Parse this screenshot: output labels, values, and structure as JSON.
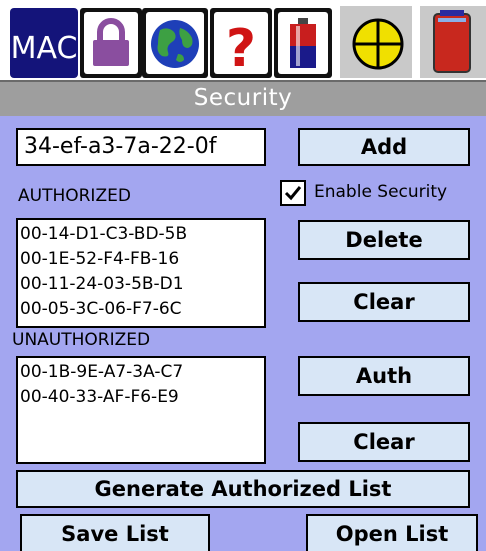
{
  "tabs": [
    {
      "label": "MAC",
      "icon": "mac-text-icon"
    },
    {
      "icon": "lock-icon"
    },
    {
      "icon": "globe-icon"
    },
    {
      "label": "?",
      "icon": "help-icon"
    },
    {
      "icon": "battery-icon"
    },
    {
      "icon": "crosshair-target-icon"
    },
    {
      "icon": "red-card-icon"
    }
  ],
  "title": "Security",
  "mac_input": {
    "value": "34-ef-a3-7a-22-0f"
  },
  "buttons": {
    "add": "Add",
    "delete": "Delete",
    "clear_authorized": "Clear",
    "auth": "Auth",
    "clear_unauthorized": "Clear",
    "generate": "Generate Authorized List",
    "save": "Save List",
    "open": "Open List"
  },
  "enable_security": {
    "label": "Enable Security",
    "checked": true
  },
  "authorized": {
    "label": "AUTHORIZED",
    "items": [
      "00-14-D1-C3-BD-5B",
      "00-1E-52-F4-FB-16",
      "00-11-24-03-5B-D1",
      "00-05-3C-06-F7-6C"
    ]
  },
  "unauthorized": {
    "label": "UNAUTHORIZED",
    "items": [
      "00-1B-9E-A7-3A-C7",
      "00-40-33-AF-F6-E9"
    ]
  },
  "colors": {
    "background": "#a3a6f0",
    "button_face": "#d8e6f6",
    "titlebar": "#9e9e9e",
    "mac_tab": "#14147a"
  }
}
